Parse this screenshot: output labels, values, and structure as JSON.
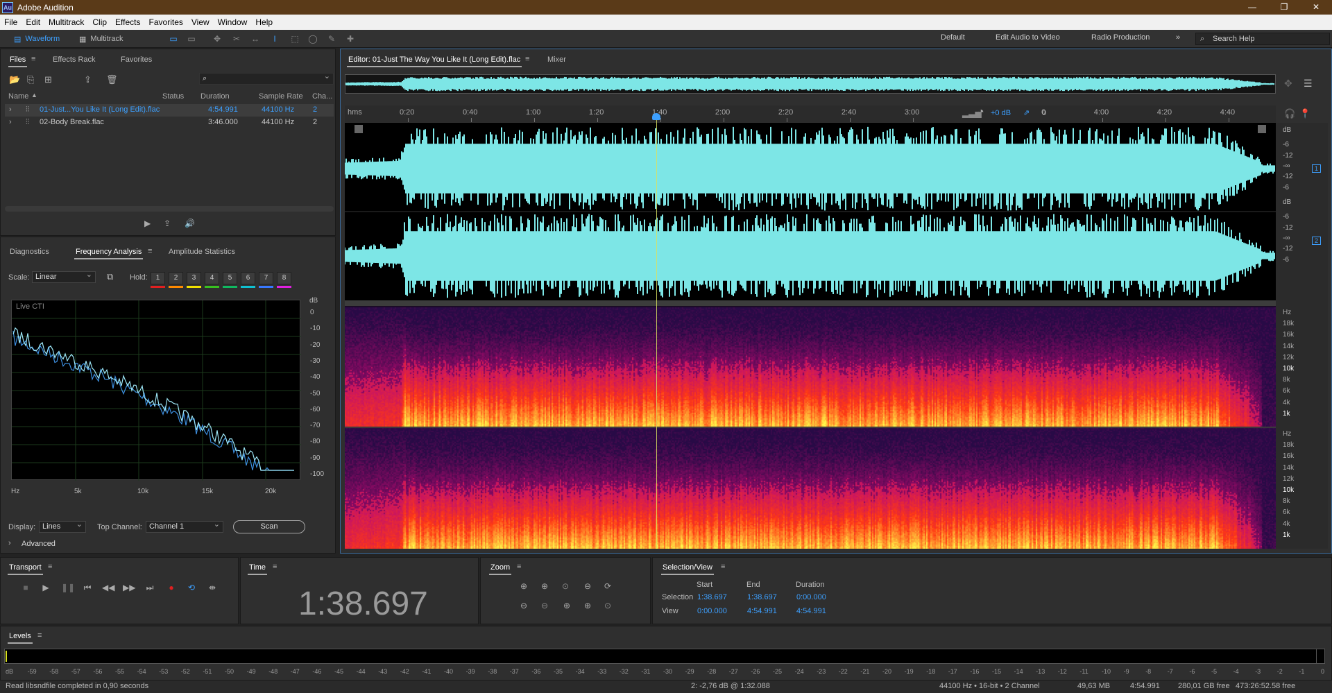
{
  "app": {
    "title": "Adobe Audition",
    "logo": "Au"
  },
  "menu": [
    "File",
    "Edit",
    "Multitrack",
    "Clip",
    "Effects",
    "Favorites",
    "View",
    "Window",
    "Help"
  ],
  "toolbar": {
    "waveform": "Waveform",
    "multitrack": "Multitrack",
    "workspaces": [
      "Default",
      "Edit Audio to Video",
      "Radio Production"
    ],
    "search_help": "Search Help"
  },
  "files_panel": {
    "tabs": [
      "Files",
      "Effects Rack",
      "Favorites"
    ],
    "search_placeholder": "",
    "columns": [
      "Name",
      "Status",
      "Duration",
      "Sample Rate",
      "Cha..."
    ],
    "rows": [
      {
        "name": "01-Just...You Like It (Long Edit).flac",
        "status": "",
        "duration": "4:54.991",
        "rate": "44100 Hz",
        "ch": "2"
      },
      {
        "name": "02-Body Break.flac",
        "status": "",
        "duration": "3:46.000",
        "rate": "44100 Hz",
        "ch": "2"
      }
    ]
  },
  "analysis_panel": {
    "tabs": [
      "Diagnostics",
      "Frequency Analysis",
      "Amplitude Statistics"
    ],
    "scale_label": "Scale:",
    "scale_value": "Linear",
    "hold_label": "Hold:",
    "holds": [
      "1",
      "2",
      "3",
      "4",
      "5",
      "6",
      "7",
      "8"
    ],
    "hold_colors": [
      "#e02020",
      "#ff8a00",
      "#f0e000",
      "#38c020",
      "#10b860",
      "#10c0d0",
      "#3878ff",
      "#e020e0"
    ],
    "live_label": "Live CTI",
    "db_unit": "dB",
    "db_ticks": [
      "0",
      "-10",
      "-20",
      "-30",
      "-40",
      "-50",
      "-60",
      "-70",
      "-80",
      "-90",
      "-100"
    ],
    "hz_ticks": [
      "Hz",
      "5k",
      "10k",
      "15k",
      "20k"
    ],
    "display_label": "Display:",
    "display_value": "Lines",
    "top_channel_label": "Top Channel:",
    "top_channel_value": "Channel 1",
    "scan": "Scan",
    "advanced": "Advanced"
  },
  "editor": {
    "tab_title": "Editor: 01-Just The Way You Like It (Long Edit).flac",
    "mixer": "Mixer",
    "ruler_unit": "hms",
    "ruler": [
      "0:20",
      "0:40",
      "1:00",
      "1:20",
      "1:40",
      "2:00",
      "2:20",
      "2:40",
      "3:00",
      "3:20",
      "3:40",
      "4:00",
      "4:20",
      "4:40"
    ],
    "ruler_seconds": [
      20,
      40,
      60,
      80,
      100,
      120,
      140,
      160,
      180,
      200,
      220,
      240,
      260,
      280
    ],
    "duration_seconds": 295,
    "playhead_seconds": 98.697,
    "gain": "+0 dB",
    "gain_zero": "0",
    "db_scale": [
      "dB",
      "-6",
      "-12",
      "-∞",
      "-12",
      "-6"
    ],
    "channels": [
      "1",
      "2"
    ],
    "hz_scale": [
      "Hz",
      "18k",
      "16k",
      "14k",
      "12k",
      "10k",
      "8k",
      "6k",
      "4k",
      "1k"
    ],
    "hz_bold": [
      "10k",
      "1k"
    ]
  },
  "transport": {
    "title": "Transport"
  },
  "time": {
    "title": "Time",
    "value": "1:38.697"
  },
  "zoom": {
    "title": "Zoom"
  },
  "selection": {
    "title": "Selection/View",
    "start": "Start",
    "end": "End",
    "duration": "Duration",
    "selection_label": "Selection",
    "view_label": "View",
    "sel_start": "1:38.697",
    "sel_end": "1:38.697",
    "sel_dur": "0:00.000",
    "view_start": "0:00.000",
    "view_end": "4:54.991",
    "view_dur": "4:54.991"
  },
  "levels": {
    "title": "Levels",
    "ticks": [
      "dB",
      "-59",
      "-58",
      "-57",
      "-56",
      "-55",
      "-54",
      "-53",
      "-52",
      "-51",
      "-50",
      "-49",
      "-48",
      "-47",
      "-46",
      "-45",
      "-44",
      "-43",
      "-42",
      "-41",
      "-40",
      "-39",
      "-38",
      "-37",
      "-36",
      "-35",
      "-34",
      "-33",
      "-32",
      "-31",
      "-30",
      "-29",
      "-28",
      "-27",
      "-26",
      "-25",
      "-24",
      "-23",
      "-22",
      "-21",
      "-20",
      "-19",
      "-18",
      "-17",
      "-16",
      "-15",
      "-14",
      "-13",
      "-12",
      "-11",
      "-10",
      "-9",
      "-8",
      "-7",
      "-6",
      "-5",
      "-4",
      "-3",
      "-2",
      "-1",
      "0"
    ]
  },
  "status": {
    "message": "Read libsndfile completed in 0,90 seconds",
    "cursor": "2: -2,76 dB @ 1:32.088",
    "format": "44100 Hz • 16-bit • 2 Channel",
    "size": "49,63 MB",
    "duration": "4:54.991",
    "free": "280,01 GB free",
    "time_free": "473:26:52.58 free"
  }
}
